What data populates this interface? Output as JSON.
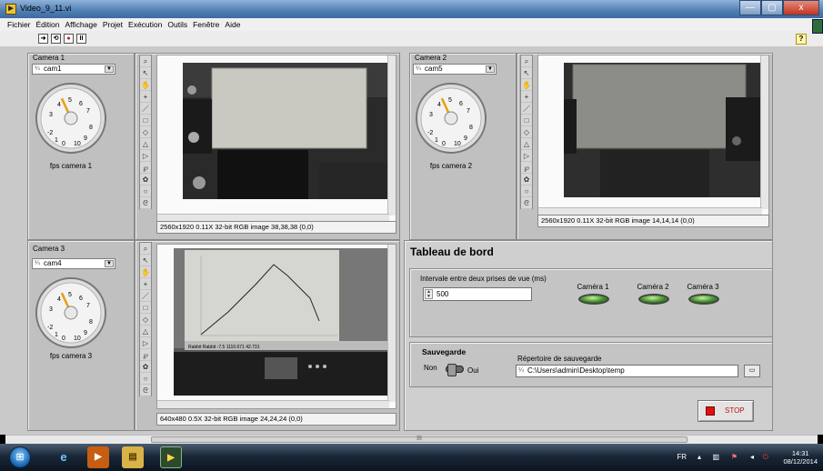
{
  "window": {
    "title": "Video_9_11.vi",
    "buttons": [
      "—",
      "▢",
      "x"
    ]
  },
  "menu": [
    "Fichier",
    "Édition",
    "Affichage",
    "Projet",
    "Exécution",
    "Outils",
    "Fenêtre",
    "Aide"
  ],
  "toolbar": {
    "run_arrow": "➜",
    "run_continuous": "⟲",
    "abort": "●",
    "pause": "II",
    "help": "?"
  },
  "cameras": [
    {
      "label": "Camera 1",
      "selected": "cam1",
      "gauge_label": "fps camera 1",
      "info": "2560x1920 0.11X 32-bit RGB image 38,38,38    (0,0)"
    },
    {
      "label": "Camera 2",
      "selected": "cam5",
      "gauge_label": "fps camera 2",
      "info": "2560x1920 0.11X 32-bit RGB image 14,14,14    (0,0)"
    },
    {
      "label": "Camera 3",
      "selected": "cam4",
      "gauge_label": "fps camera 3",
      "info": "640x480 0.5X 32-bit RGB image 24,24,24    (0,0)"
    }
  ],
  "gauge_ticks": [
    "-2",
    "1",
    "0",
    "10",
    "9",
    "8",
    "7",
    "6",
    "5",
    "4",
    "3"
  ],
  "gauge_value": 3,
  "dashboard": {
    "title": "Tableau de bord",
    "interval_label": "Intervale entre deux prises de vue (ms)",
    "interval_value": "500",
    "leds": [
      "Caméra 1",
      "Caméra 2",
      "Caméra 3"
    ],
    "save_title": "Sauvegarde",
    "save_off": "Non",
    "save_on": "Oui",
    "dir_label": "Répertoire de sauvegarde",
    "dir_value": "C:\\Users\\admin\\Desktop\\temp",
    "stop_label": "STOP"
  },
  "scrollbar_grip": "III",
  "photo3_readout": "Rabbit  Rabbit  -7.5  1110.671  42.731",
  "taskbar": {
    "apps": [
      "IE",
      "WMP",
      "Explorer",
      "LabVIEW"
    ],
    "lang": "FR",
    "time": "14:31",
    "date": "08/12/2014"
  }
}
